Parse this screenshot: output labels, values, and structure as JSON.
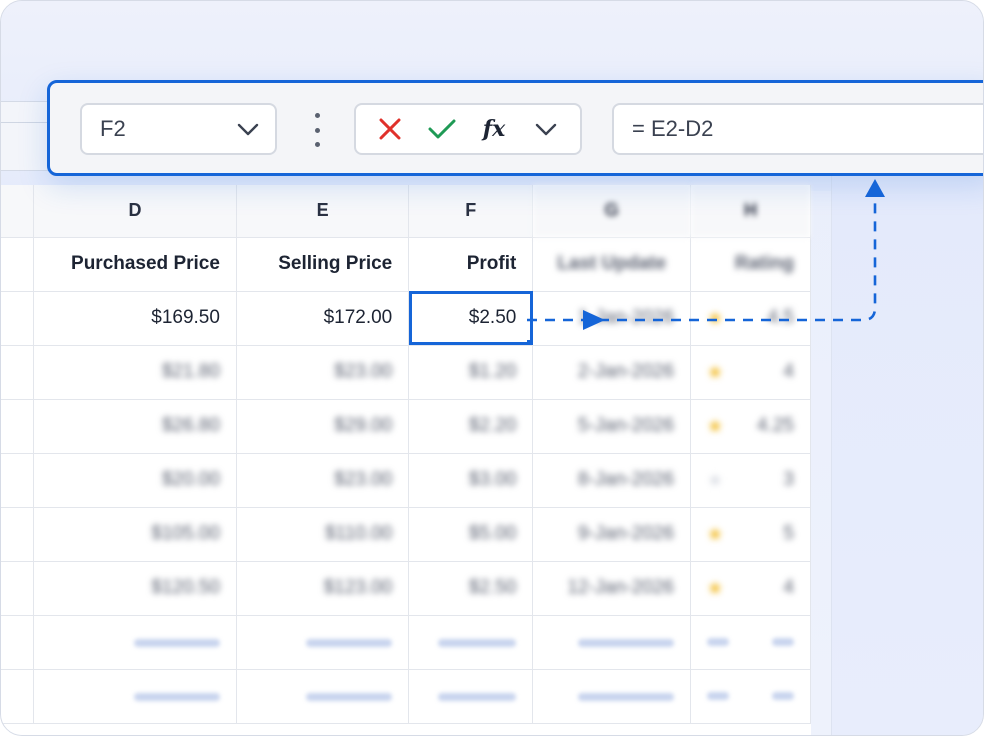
{
  "toolbar": {
    "name_box": "F2",
    "formula": "= E2-D2",
    "fx_label": "fx"
  },
  "columns": [
    "D",
    "E",
    "F",
    "G",
    "H"
  ],
  "header_row": {
    "D": "Purchased Price",
    "E": "Selling Price",
    "F": "Profit",
    "G": "Last Update",
    "H": "Rating"
  },
  "rows": [
    {
      "D": "$169.50",
      "E": "$172.00",
      "F": "$2.50",
      "G": "1-Jan-2026",
      "H": "4.5",
      "star": "full"
    },
    {
      "D": "$21.80",
      "E": "$23.00",
      "F": "$1.20",
      "G": "2-Jan-2026",
      "H": "4",
      "star": "full"
    },
    {
      "D": "$26.80",
      "E": "$29.00",
      "F": "$2.20",
      "G": "5-Jan-2026",
      "H": "4.25",
      "star": "full"
    },
    {
      "D": "$20.00",
      "E": "$23.00",
      "F": "$3.00",
      "G": "8-Jan-2026",
      "H": "3",
      "star": "empty"
    },
    {
      "D": "$105.00",
      "E": "$110.00",
      "F": "$5.00",
      "G": "9-Jan-2026",
      "H": "5",
      "star": "full"
    },
    {
      "D": "$120.50",
      "E": "$123.00",
      "F": "$2.50",
      "G": "12-Jan-2026",
      "H": "4",
      "star": "full"
    }
  ],
  "selected_cell": "F2",
  "colors": {
    "accent": "#1565d8",
    "cancel": "#e0312b",
    "confirm": "#1f9a55",
    "star": "#f1b71c"
  },
  "icons": [
    "cancel-x-icon",
    "confirm-check-icon",
    "fx-icon",
    "chevron-down-icon",
    "kebab-menu-icon",
    "star-icon"
  ]
}
